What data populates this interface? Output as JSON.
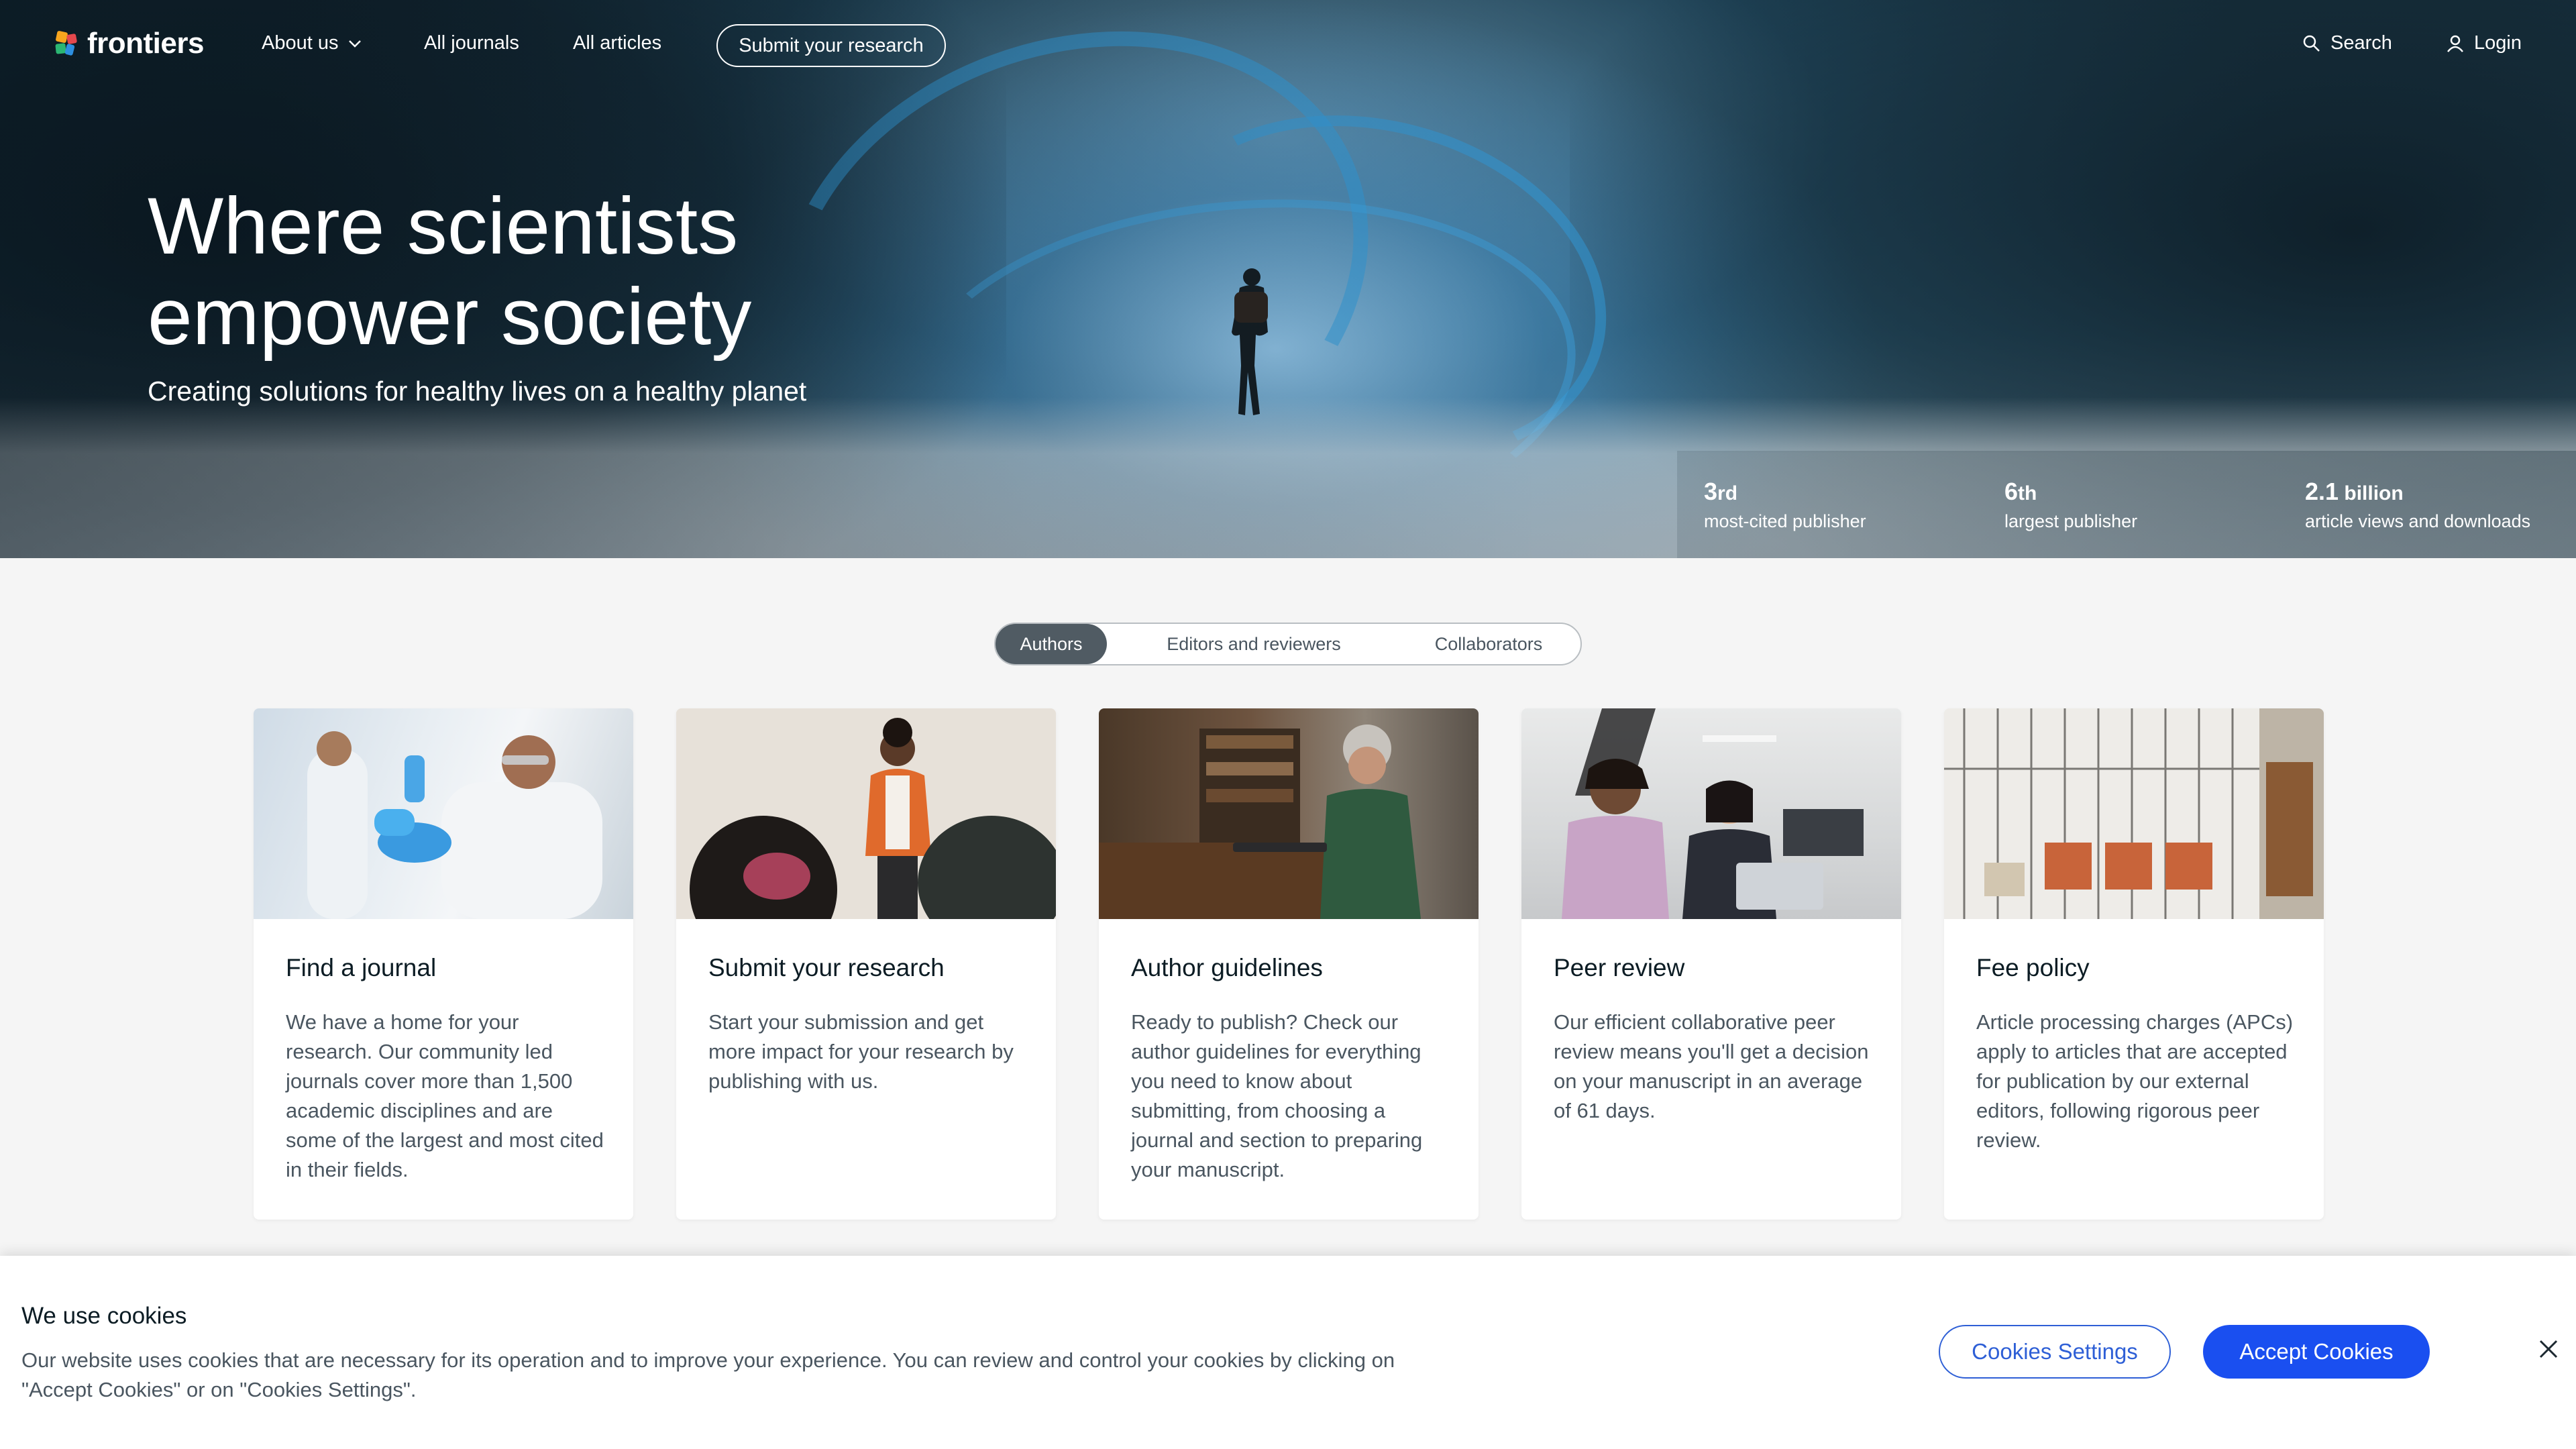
{
  "nav": {
    "logo_text": "frontiers",
    "about_label": "About us",
    "journals_label": "All journals",
    "articles_label": "All articles",
    "submit_label": "Submit your research",
    "search_label": "Search",
    "login_label": "Login"
  },
  "hero": {
    "title": "Where scientists empower society",
    "subtitle": "Creating solutions for healthy lives on a healthy planet"
  },
  "stats": [
    {
      "value": "3",
      "suffix": "rd",
      "label": "most-cited publisher"
    },
    {
      "value": "6",
      "suffix": "th",
      "label": "largest publisher"
    },
    {
      "value": "2.1",
      "suffix": " billion",
      "label": "article views and downloads"
    }
  ],
  "tabs": [
    {
      "label": "Authors",
      "active": true
    },
    {
      "label": "Editors and reviewers",
      "active": false
    },
    {
      "label": "Collaborators",
      "active": false
    }
  ],
  "cards": [
    {
      "title": "Find a journal",
      "description": "We have a home for your research. Our community led journals cover more than 1,500 academic disciplines and are some of the largest and most cited in their fields."
    },
    {
      "title": "Submit your research",
      "description": "Start your submission and get more impact for your research by publishing with us."
    },
    {
      "title": "Author guidelines",
      "description": "Ready to publish? Check our author guidelines for everything you need to know about submitting, from choosing a journal and section to preparing your manuscript."
    },
    {
      "title": "Peer review",
      "description": "Our efficient collaborative peer review means you'll get a decision on your manuscript in an average of 61 days."
    },
    {
      "title": "Fee policy",
      "description": "Article processing charges (APCs) apply to articles that are accepted for publication by our external editors, following rigorous peer review."
    }
  ],
  "cookie": {
    "title": "We use cookies",
    "text": "Our website uses cookies that are necessary for its operation and to improve your experience. You can review and control your cookies by clicking on \"Accept Cookies\" or on \"Cookies Settings\".",
    "settings_label": "Cookies Settings",
    "accept_label": "Accept Cookies"
  },
  "colors": {
    "accent_blue": "#1a4ff0",
    "tab_active": "#505b63",
    "text_dark": "#0c1c24",
    "text_muted": "#4a5660"
  }
}
